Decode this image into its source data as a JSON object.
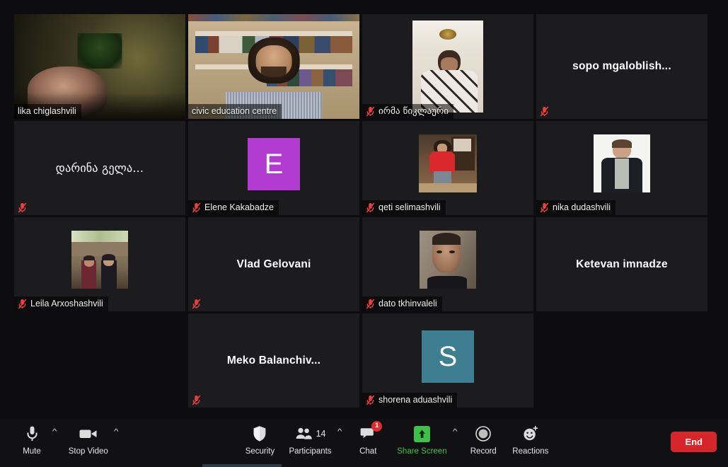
{
  "meeting": {
    "active_speaker_border_color": "#c3e223",
    "tile_background": "#1c1c1e",
    "window_background": "#0d0d0f"
  },
  "tiles": [
    {
      "id": "lika-chiglashvili",
      "name": "lika chiglashvili",
      "layout": "video-full",
      "muted": false,
      "active_speaker": false,
      "script": "latin"
    },
    {
      "id": "civic-education-centre",
      "name": "civic education centre",
      "layout": "video-full",
      "muted": false,
      "active_speaker": true,
      "script": "latin"
    },
    {
      "id": "irma-tsiklauri",
      "name": "ირმა წიკლაური",
      "layout": "video-thumb",
      "muted": true,
      "active_speaker": false,
      "script": "georgian"
    },
    {
      "id": "sopo-mgaloblishvili",
      "name": "sopo  mgaloblish...",
      "layout": "name-only",
      "muted": true,
      "active_speaker": false,
      "script": "latin"
    },
    {
      "id": "darina-gelashvili",
      "name": "დარინა გელა...",
      "layout": "name-only",
      "muted": true,
      "active_speaker": false,
      "script": "georgian"
    },
    {
      "id": "elene-kakabadze",
      "name": "Elene Kakabadze",
      "layout": "avatar",
      "initial": "E",
      "avatar_color": "#b13ad1",
      "muted": true,
      "active_speaker": false,
      "script": "latin"
    },
    {
      "id": "qeti-selimashvili",
      "name": "qeti selimashvili",
      "layout": "video-thumb",
      "muted": true,
      "active_speaker": false,
      "script": "latin"
    },
    {
      "id": "nika-dudashvili",
      "name": "nika dudashvili",
      "layout": "video-thumb",
      "muted": true,
      "active_speaker": false,
      "script": "latin"
    },
    {
      "id": "leila-arxoshashvili",
      "name": "Leila Arxoshashvili",
      "layout": "video-thumb",
      "muted": true,
      "active_speaker": false,
      "script": "latin"
    },
    {
      "id": "vlad-gelovani",
      "name": "Vlad Gelovani",
      "layout": "name-only",
      "muted": true,
      "active_speaker": false,
      "script": "latin"
    },
    {
      "id": "dato-tkhinvaleli",
      "name": "dato tkhinvaleli",
      "layout": "video-thumb",
      "muted": true,
      "active_speaker": false,
      "script": "latin"
    },
    {
      "id": "ketevan-imnadze",
      "name": "Ketevan imnadze",
      "layout": "name-only",
      "muted": false,
      "active_speaker": false,
      "script": "latin"
    },
    {
      "id": "meko-balanchivadze",
      "name": "Meko  Balanchiv...",
      "layout": "name-only",
      "muted": true,
      "active_speaker": false,
      "script": "latin"
    },
    {
      "id": "shorena-aduashvili",
      "name": "shorena aduashvili",
      "layout": "avatar",
      "initial": "S",
      "avatar_color": "#3d7f91",
      "muted": true,
      "active_speaker": false,
      "script": "latin"
    }
  ],
  "toolbar": {
    "mute": {
      "label": "Mute",
      "icon": "microphone-icon",
      "has_caret": true
    },
    "video": {
      "label": "Stop Video",
      "icon": "video-camera-icon",
      "has_caret": true
    },
    "security": {
      "label": "Security",
      "icon": "shield-icon"
    },
    "participants": {
      "label": "Participants",
      "icon": "people-icon",
      "count": "14",
      "has_caret": true
    },
    "chat": {
      "label": "Chat",
      "icon": "chat-bubble-icon",
      "badge": "1"
    },
    "share_screen": {
      "label": "Share Screen",
      "icon": "share-screen-icon",
      "color": "#41c14a",
      "has_caret": true
    },
    "record": {
      "label": "Record",
      "icon": "record-circle-icon"
    },
    "reactions": {
      "label": "Reactions",
      "icon": "smiley-plus-icon"
    },
    "end": {
      "label": "End",
      "color": "#d6262c"
    }
  }
}
